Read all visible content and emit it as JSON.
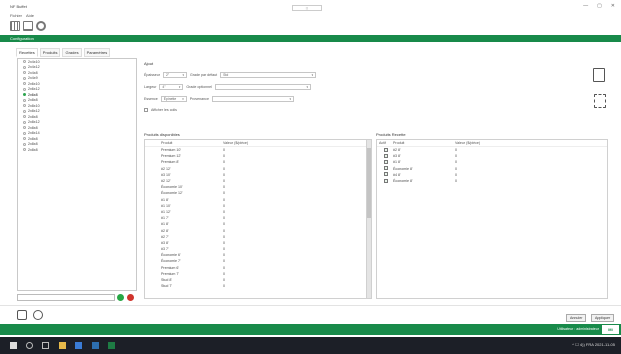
{
  "app": {
    "title": "NF Buffet",
    "center_tag": "[ ]",
    "window_controls": [
      "—",
      "▢",
      "✕"
    ]
  },
  "menubar": {
    "items": [
      "Fichier",
      "Aide"
    ]
  },
  "toolbar": {
    "icons": [
      "grid-icon",
      "laptop-icon",
      "user-icon"
    ]
  },
  "config_bar": {
    "title": "Configuration"
  },
  "tabs": [
    {
      "label": "Recettes"
    },
    {
      "label": "Produits"
    },
    {
      "label": "Grades"
    },
    {
      "label": "Paramètres"
    }
  ],
  "recipes": [
    "2x4x10",
    "2x4x12",
    "2x4x8",
    "2x4x9",
    "2x6x10",
    "2x6x12",
    "2x6x8",
    "2x8x8",
    "2x8x10",
    "2x8x12",
    "2x8x8",
    "2x8x12",
    "2x8x8",
    "2x8x14",
    "2x8x8",
    "2x8x8",
    "2x8x8"
  ],
  "selected_recipe_index": 6,
  "section": {
    "title": "Ajout"
  },
  "form": {
    "epaisseur_label": "Épaisseur",
    "epaisseur_value": "2\"",
    "grade_label": "Grade par défaut",
    "grade_value": "Std",
    "largeur_label": "Largeur",
    "largeur_value": "4\"",
    "grade_opt_label": "Grade optionnel",
    "grade_opt_value": "",
    "essence_label": "Essence",
    "essence_value": "Épinette",
    "provenance_label": "Provenance",
    "provenance_value": "",
    "show_all_label": "Afficher les colis"
  },
  "available_panel": {
    "title": "Produits disponibles",
    "col_product": "Produit",
    "col_value": "Valeur ($/pièce)",
    "rows": [
      [
        "Premium 10'",
        "0"
      ],
      [
        "Premium 12'",
        "0"
      ],
      [
        "Premium 8'",
        "0"
      ],
      [
        "#2 12'",
        "0"
      ],
      [
        "#3 10'",
        "0"
      ],
      [
        "#2 12'",
        "0"
      ],
      [
        "Économie 10'",
        "0"
      ],
      [
        "Économie 12'",
        "0"
      ],
      [
        "#1 8'",
        "0"
      ],
      [
        "#1 10'",
        "0"
      ],
      [
        "#1 12'",
        "0"
      ],
      [
        "#1 7'",
        "0"
      ],
      [
        "#1 8'",
        "0"
      ],
      [
        "#2 8'",
        "0"
      ],
      [
        "#2 7'",
        "0"
      ],
      [
        "#3 8'",
        "0"
      ],
      [
        "#3 7'",
        "0"
      ],
      [
        "Économie 6'",
        "0"
      ],
      [
        "Économie 7'",
        "0"
      ],
      [
        "Premium 6'",
        "0"
      ],
      [
        "Premium 7'",
        "0"
      ],
      [
        "Stud 8'",
        "0"
      ],
      [
        "Stud 7'",
        "0"
      ]
    ]
  },
  "recipe_panel": {
    "title": "Produits Recette",
    "col_actif": "Actif",
    "col_product": "Produit",
    "col_value": "Valeur ($/pièce)",
    "rows": [
      [
        "#2 8'",
        "0"
      ],
      [
        "#3 8'",
        "0"
      ],
      [
        "#1 8'",
        "0"
      ],
      [
        "Économie 8'",
        "0"
      ],
      [
        "#4 8'",
        "0"
      ],
      [
        "Économie 8'",
        "0"
      ]
    ]
  },
  "side_icons": [
    "export-icon",
    "list-edit-icon"
  ],
  "bottom": {
    "icons": [
      "print-icon",
      "refresh-icon"
    ],
    "buttons": [
      "Annuler",
      "Appliquer"
    ]
  },
  "status": {
    "text": "Utilisateur : administrateur",
    "logo": "Mi"
  },
  "taskbar": {
    "tray": "^ ☐ 4)) FRA 2021-11-05"
  }
}
